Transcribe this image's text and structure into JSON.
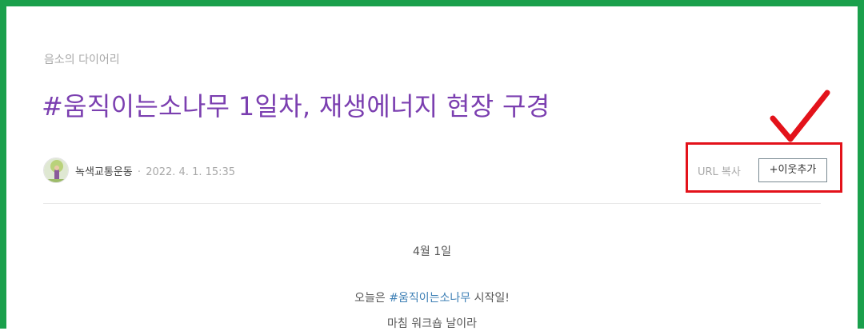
{
  "post": {
    "category": "음소의 다이어리",
    "title": "#움직이는소나무 1일차, 재생에너지 현장 구경",
    "author": "녹색교통운동",
    "separator": "·",
    "date": "2022. 4. 1. 15:35"
  },
  "actions": {
    "url_copy_label": "URL 복사",
    "add_neighbor_label": "+이웃추가"
  },
  "content": {
    "heading": "4월 1일",
    "line1_prefix": "오늘은 ",
    "line1_hashtag": "#움직이는소나무",
    "line1_suffix": " 시작일!",
    "line2": "마침 워크숍 날이라"
  },
  "annotation": {
    "box_color": "#e3121a",
    "check_color": "#e3121a"
  },
  "colors": {
    "frame": "#1aa04c",
    "title": "#7b3fb0",
    "hashtag": "#3d7fb5"
  },
  "icons": {
    "avatar": "profile-avatar",
    "check": "checkmark-icon"
  }
}
